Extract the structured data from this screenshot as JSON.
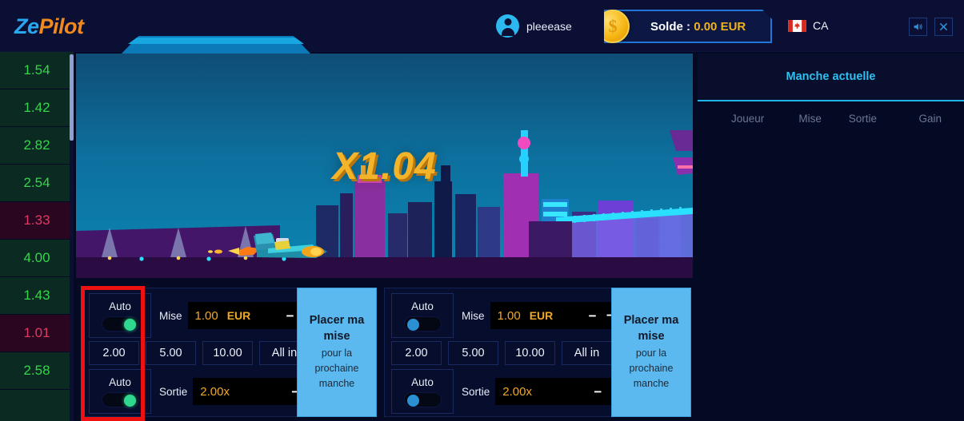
{
  "header": {
    "logo": {
      "part1": "Ze",
      "part2": "Pilot",
      "color1": "#29a8ef",
      "color2": "#f08a1e"
    },
    "user": {
      "name": "pleeease",
      "avatar_icon": "user-avatar-icon"
    },
    "balance": {
      "label": "Solde :",
      "amount": "0.00",
      "currency": "EUR",
      "coin_icon": "gold-coin-icon",
      "symbol": "$"
    },
    "locale": {
      "code": "CA",
      "flag_icon": "canada-flag-icon"
    },
    "buttons": [
      {
        "name": "sound-toggle",
        "icon": "speaker-icon",
        "glyph": "🔊"
      },
      {
        "name": "close-window",
        "icon": "close-icon",
        "glyph": "✕"
      }
    ]
  },
  "history": {
    "items": [
      {
        "value": "1.54",
        "state": "win"
      },
      {
        "value": "1.42",
        "state": "win"
      },
      {
        "value": "2.82",
        "state": "win"
      },
      {
        "value": "2.54",
        "state": "win"
      },
      {
        "value": "1.33",
        "state": "lose"
      },
      {
        "value": "4.00",
        "state": "win"
      },
      {
        "value": "1.43",
        "state": "win"
      },
      {
        "value": "1.01",
        "state": "lose"
      },
      {
        "value": "2.58",
        "state": "win"
      },
      {
        "value": "",
        "state": "win"
      }
    ]
  },
  "game": {
    "multiplier": "X1.04",
    "multiplier_color": "#f4b42a"
  },
  "side_panel": {
    "tab": "Manche actuelle",
    "columns": [
      "Joueur",
      "Mise",
      "Sortie",
      "Gain"
    ],
    "rows": []
  },
  "bet_panels": [
    {
      "id": "left",
      "auto_bet": {
        "label": "Auto",
        "state": "on"
      },
      "bet": {
        "label": "Mise",
        "value": "1.00",
        "currency": "EUR",
        "minus": "−",
        "plus": "＋"
      },
      "quick": [
        "2.00",
        "5.00",
        "10.00",
        "All in"
      ],
      "auto_cashout": {
        "label": "Auto",
        "state": "on"
      },
      "cashout": {
        "label": "Sortie",
        "value": "2.00x",
        "minus": "−",
        "plus": "＋"
      },
      "place_button": {
        "main": "Placer ma mise",
        "sub": "pour la prochaine manche"
      }
    },
    {
      "id": "right",
      "auto_bet": {
        "label": "Auto",
        "state": "off"
      },
      "bet": {
        "label": "Mise",
        "value": "1.00",
        "currency": "EUR",
        "minus": "−",
        "plus": "＋"
      },
      "quick": [
        "2.00",
        "5.00",
        "10.00",
        "All in"
      ],
      "auto_cashout": {
        "label": "Auto",
        "state": "off"
      },
      "cashout": {
        "label": "Sortie",
        "value": "2.00x",
        "minus": "−",
        "plus": "＋"
      },
      "place_button": {
        "main": "Placer ma mise",
        "sub": "pour la prochaine manche"
      }
    }
  ],
  "annotation": {
    "highlight_color": "#ee1111"
  }
}
